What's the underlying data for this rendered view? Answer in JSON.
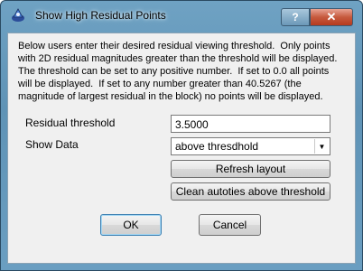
{
  "window": {
    "title": "Show High Residual Points",
    "help_label": "?",
    "close_label": "✕"
  },
  "description": "Below users enter their desired residual viewing threshold.  Only points\nwith 2D residual magnitudes greater than the threshold will be displayed.\nThe threshold can be set to any positive number.  If set to 0.0 all points\nwill be displayed.  If set to any number greater than 40.5267 (the\nmagnitude of largest residual in the block) no points will be displayed.",
  "form": {
    "threshold_label": "Residual threshold",
    "threshold_value": "3.5000",
    "show_data_label": "Show Data",
    "show_data_value": "above thresdhold"
  },
  "buttons": {
    "refresh": "Refresh layout",
    "clean": "Clean autoties above threshold",
    "ok": "OK",
    "cancel": "Cancel"
  }
}
